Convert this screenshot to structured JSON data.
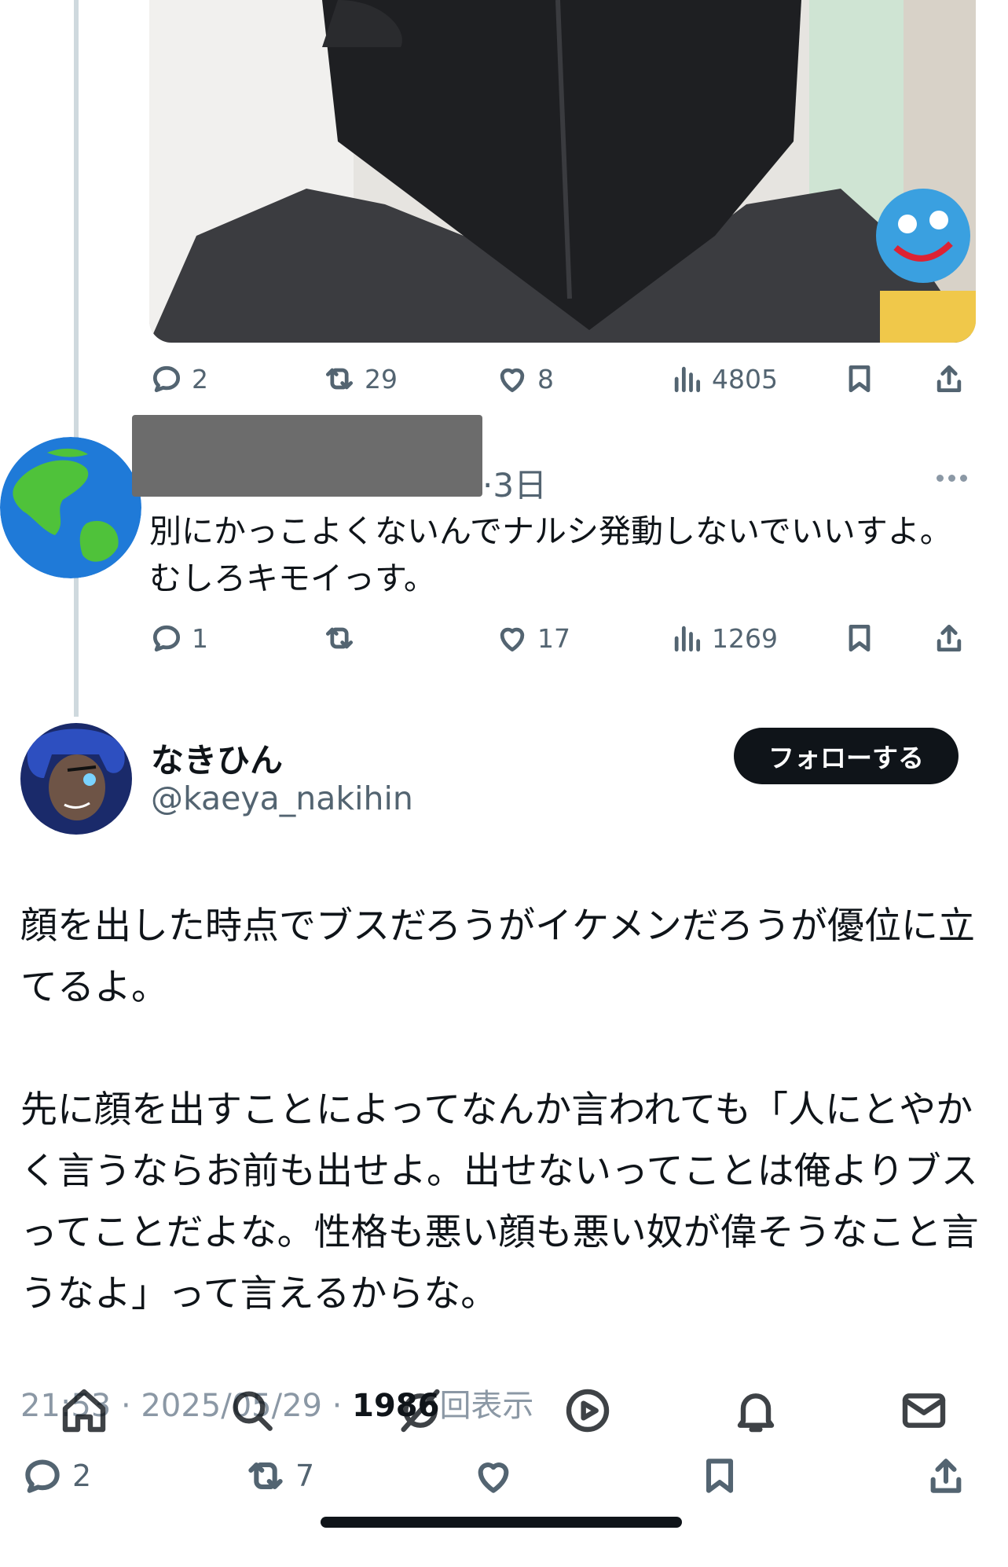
{
  "first_tweet": {
    "stats": {
      "replies": "2",
      "retweets": "29",
      "likes": "8",
      "views": "4805"
    }
  },
  "reply": {
    "time": "·3日",
    "text": "別にかっこよくないんでナルシ発動しないでいいすよ。むしろキモイっす。",
    "stats": {
      "replies": "1",
      "retweets": "",
      "likes": "17",
      "views": "1269"
    }
  },
  "main_tweet": {
    "display_name": "なきひん",
    "handle": "@kaeya_nakihin",
    "follow_label": "フォローする",
    "text": "顔を出した時点でブスだろうがイケメンだろうが優位に立てるよ。\n\n先に顔を出すことによってなんか言われても「人にとやかく言うならお前も出せよ。出せないってことは俺よりブスってことだよな。性格も悪い顔も悪い奴が偉そうなこと言うなよ」って言えるからな。",
    "meta_prefix": "21:53 · 2025/05/29 · ",
    "views_count": "1986",
    "views_suffix": "回表示",
    "stats": {
      "replies": "2",
      "retweets": "7"
    }
  },
  "icons": [
    "reply-icon",
    "retweet-icon",
    "like-icon",
    "views-icon",
    "bookmark-icon",
    "share-icon",
    "home-icon",
    "search-icon",
    "grok-icon",
    "video-icon",
    "notification-icon",
    "messages-icon"
  ]
}
